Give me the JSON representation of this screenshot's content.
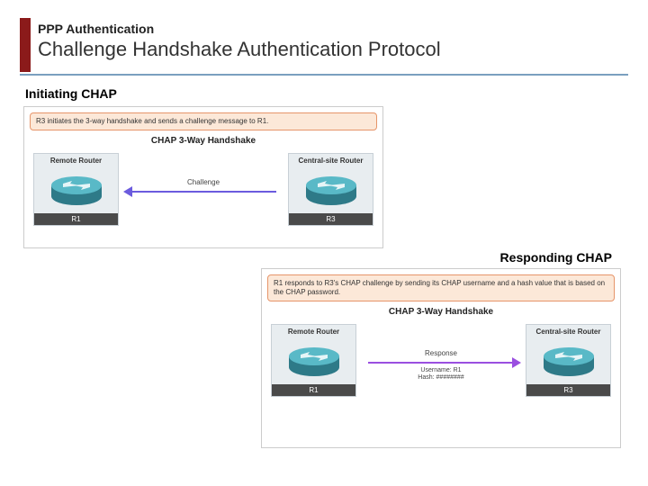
{
  "colors": {
    "accent": "#8B1A1A",
    "arrow1": "#6B5BDE",
    "arrow2": "#9A4FE0"
  },
  "header": {
    "subtitle": "PPP Authentication",
    "title": "Challenge Handshake Authentication Protocol"
  },
  "section1": {
    "label": "Initiating CHAP",
    "diagram": {
      "note": "R3 initiates the 3-way handshake and sends a challenge message to R1.",
      "title": "CHAP 3-Way Handshake",
      "left_router": {
        "caption": "Remote Router",
        "name": "R1"
      },
      "right_router": {
        "caption": "Central-site Router",
        "name": "R3"
      },
      "arrow_label": "Challenge",
      "arrow_direction": "left"
    }
  },
  "section2": {
    "label": "Responding CHAP",
    "diagram": {
      "note": "R1 responds to R3's CHAP challenge by sending its CHAP username and a hash value that is based on the CHAP password.",
      "title": "CHAP 3-Way Handshake",
      "left_router": {
        "caption": "Remote Router",
        "name": "R1"
      },
      "right_router": {
        "caption": "Central-site Router",
        "name": "R3"
      },
      "arrow_label": "Response",
      "arrow_sublabel": "Username: R1\nHash: ########",
      "arrow_direction": "right"
    }
  }
}
